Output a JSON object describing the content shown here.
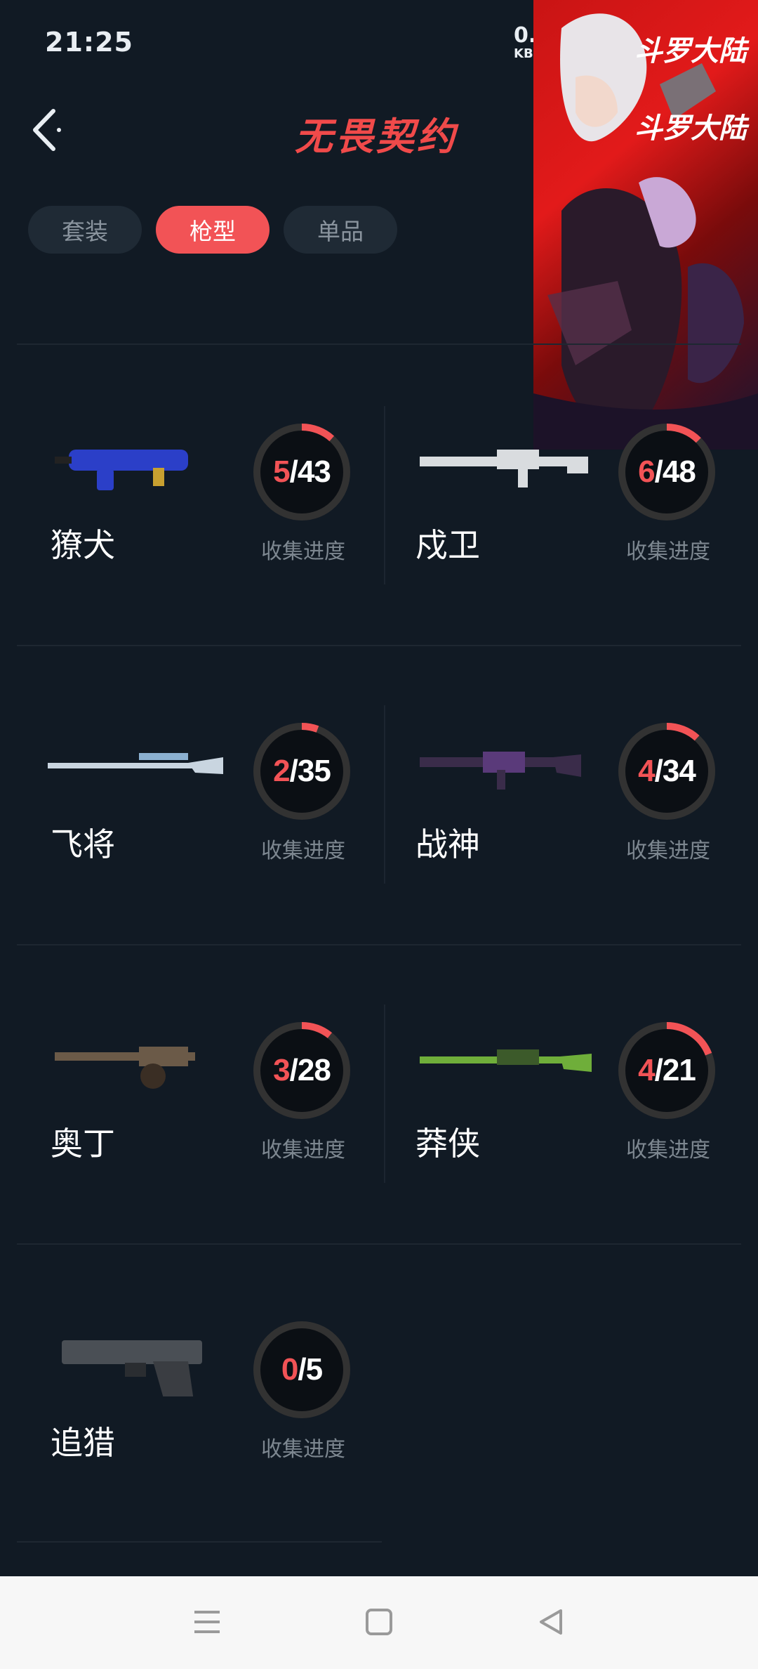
{
  "status": {
    "time": "21:25",
    "net_speed": "0.",
    "net_unit": "KB"
  },
  "header": {
    "title": "无畏契约",
    "back_icon": "chevron-left-icon"
  },
  "tabs": [
    {
      "label": "套装",
      "active": false
    },
    {
      "label": "枪型",
      "active": true
    },
    {
      "label": "单品",
      "active": false
    }
  ],
  "banner": {
    "logo_text": "斗罗大陆"
  },
  "weapons": [
    {
      "name": "獠犬",
      "collected": "5",
      "total": "43",
      "progress_label": "收集进度",
      "color": "#2b3fc8"
    },
    {
      "name": "戍卫",
      "collected": "6",
      "total": "48",
      "progress_label": "收集进度",
      "color": "#d9dcdf"
    },
    {
      "name": "飞将",
      "collected": "2",
      "total": "35",
      "progress_label": "收集进度",
      "color": "#c9d5e0"
    },
    {
      "name": "战神",
      "collected": "4",
      "total": "34",
      "progress_label": "收集进度",
      "color": "#3a2c4a"
    },
    {
      "name": "奥丁",
      "collected": "3",
      "total": "28",
      "progress_label": "收集进度",
      "color": "#6b5a48"
    },
    {
      "name": "莽侠",
      "collected": "4",
      "total": "21",
      "progress_label": "收集进度",
      "color": "#6fae3a"
    },
    {
      "name": "追猎",
      "collected": "0",
      "total": "5",
      "progress_label": "收集进度",
      "color": "#4a4f55"
    }
  ],
  "navbar": {
    "menu_icon": "menu-icon",
    "home_icon": "home-square-icon",
    "back_icon": "back-triangle-icon"
  }
}
